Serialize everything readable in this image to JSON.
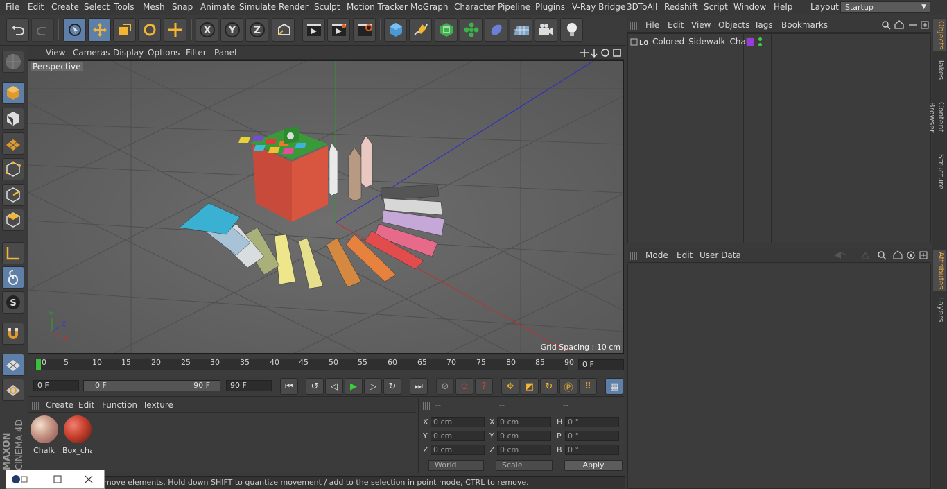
{
  "menubar": {
    "items": [
      "File",
      "Edit",
      "Create",
      "Select",
      "Tools",
      "Mesh",
      "Snap",
      "Animate",
      "Simulate",
      "Render",
      "Sculpt",
      "Motion Tracker",
      "MoGraph",
      "Character",
      "Pipeline",
      "Plugins",
      "V-Ray Bridge",
      "3DToAll",
      "Redshift",
      "Script",
      "Window",
      "Help"
    ],
    "layout_label": "Layout:",
    "layout_value": "Startup"
  },
  "toolbar": {
    "icons": [
      "undo-icon",
      "redo-icon",
      "select-arrow-icon",
      "move-icon",
      "scale-icon",
      "rotate-icon",
      "transform-icon",
      "x-axis-icon",
      "y-axis-icon",
      "z-axis-icon",
      "coordinate-system-icon",
      "render-view-icon",
      "render-picture-viewer-icon",
      "render-settings-icon",
      "cube-icon",
      "pen-icon",
      "subdivision-icon",
      "mograph-cloner-icon",
      "deformer-icon",
      "floor-icon",
      "camera-icon",
      "light-icon"
    ]
  },
  "viewport": {
    "menu": [
      "View",
      "Cameras",
      "Display",
      "Options",
      "Filter",
      "Panel"
    ],
    "label": "Perspective",
    "grid_spacing": "Grid Spacing : 10 cm"
  },
  "timeline": {
    "ticks": [
      "0",
      "5",
      "10",
      "15",
      "20",
      "25",
      "30",
      "35",
      "40",
      "45",
      "50",
      "55",
      "60",
      "65",
      "70",
      "75",
      "80",
      "85",
      "90"
    ],
    "frame_end": "0 F"
  },
  "transport": {
    "current_frame": "0 F",
    "range_start": "0 F",
    "range_end": "90 F",
    "max_frame": "90 F"
  },
  "materials": {
    "menu": [
      "Create",
      "Edit",
      "Function",
      "Texture"
    ],
    "items": [
      {
        "name": "Chalk"
      },
      {
        "name": "Box_cha"
      }
    ]
  },
  "coordinates": {
    "headers": [
      "--",
      "--",
      "--"
    ],
    "pos_labels": [
      "X",
      "Y",
      "Z"
    ],
    "size_labels": [
      "X",
      "Y",
      "Z"
    ],
    "rot_labels": [
      "H",
      "P",
      "B"
    ],
    "pos_values": [
      "0 cm",
      "0 cm",
      "0 cm"
    ],
    "size_values": [
      "0 cm",
      "0 cm",
      "0 cm"
    ],
    "rot_values": [
      "0 °",
      "0 °",
      "0 °"
    ],
    "mode_world": "World",
    "mode_scale": "Scale",
    "apply": "Apply"
  },
  "status": {
    "text": "move elements. Hold down SHIFT to quantize movement / add to the selection in point mode, CTRL to remove."
  },
  "objects": {
    "menu": [
      "File",
      "Edit",
      "View",
      "Objects",
      "Tags",
      "Bookmarks"
    ],
    "items": [
      {
        "name": "Colored_Sidewalk_Chalk"
      }
    ]
  },
  "attributes": {
    "menu": [
      "Mode",
      "Edit",
      "User Data"
    ]
  },
  "side_tabs": [
    "Objects",
    "Takes",
    "Content Browser",
    "Structure",
    "Attributes",
    "Layers"
  ],
  "branding": {
    "logo_line1": "MAXON",
    "logo_line2": "CINEMA 4D"
  },
  "colors": {
    "accent": "#5d7fa8",
    "tab_active": "#e8a640",
    "viewport_bg": "#5d5d5d"
  }
}
